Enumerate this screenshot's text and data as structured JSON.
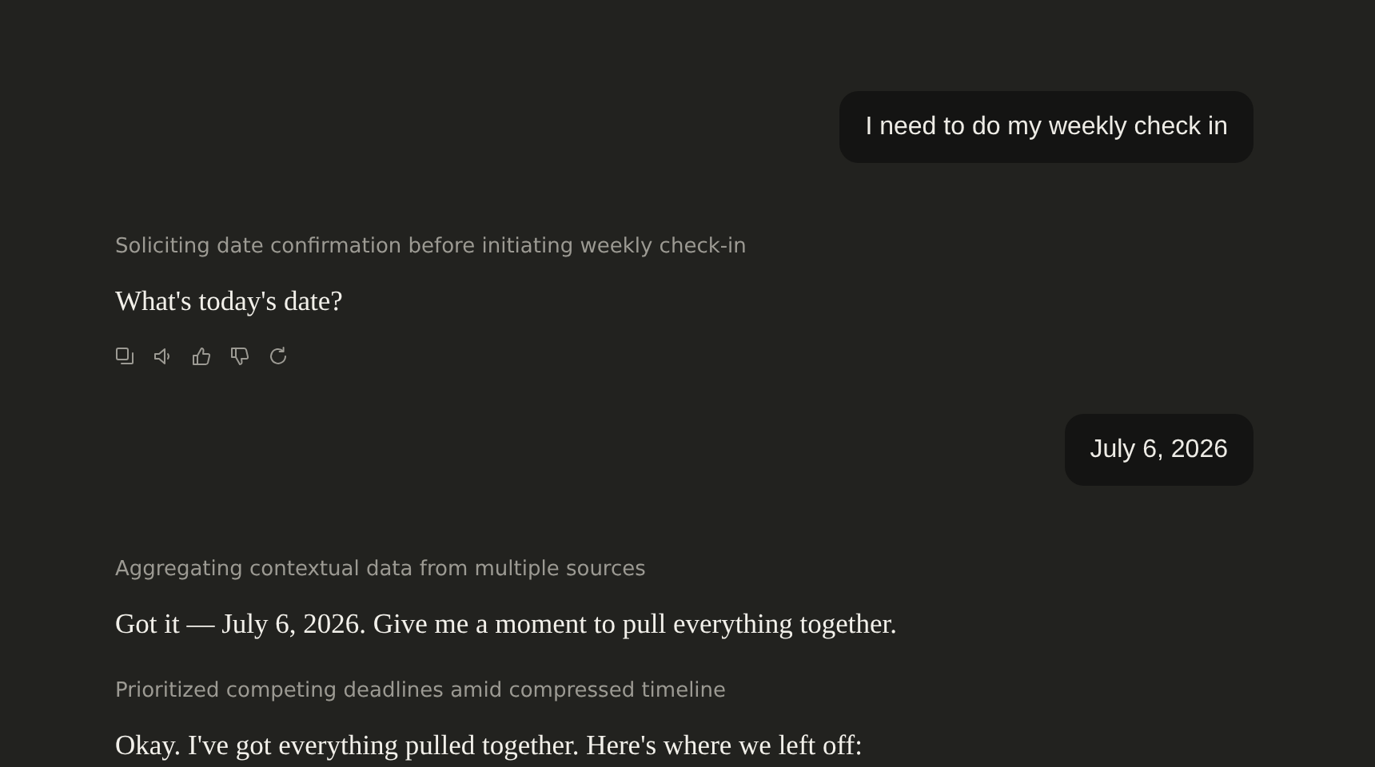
{
  "messages": [
    {
      "kind": "user",
      "text": "I need to do my weekly check in"
    },
    {
      "kind": "assistant",
      "actions": true,
      "blocks": [
        {
          "summary": "Soliciting date confirmation before initiating weekly check-in",
          "text": "What's today's date?"
        }
      ]
    },
    {
      "kind": "user",
      "text": "July 6, 2026"
    },
    {
      "kind": "assistant",
      "blocks": [
        {
          "summary": "Aggregating contextual data from multiple sources",
          "text": "Got it — July 6, 2026. Give me a moment to pull everything together."
        },
        {
          "summary": "Prioritized competing deadlines amid compressed timeline",
          "text": "Okay. I've got everything pulled together. Here's where we left off:"
        }
      ]
    }
  ]
}
